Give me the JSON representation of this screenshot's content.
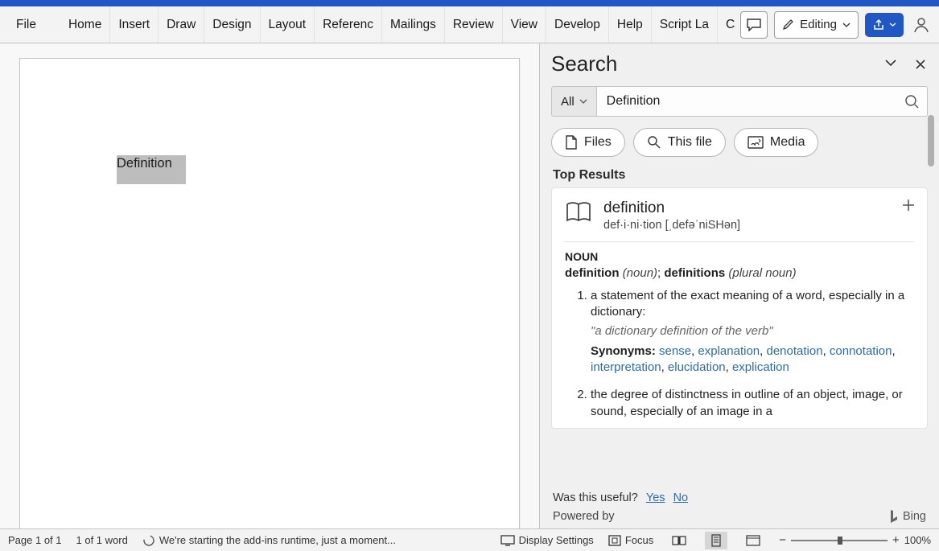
{
  "ribbon": {
    "tabs": [
      "File",
      "Home",
      "Insert",
      "Draw",
      "Design",
      "Layout",
      "Referenc",
      "Mailings",
      "Review",
      "View",
      "Develop",
      "Help",
      "Script La",
      "Callout a"
    ],
    "editing_label": "Editing"
  },
  "document": {
    "selection_text": "Definition"
  },
  "search": {
    "title": "Search",
    "scope": "All",
    "query": "Definition",
    "pills": [
      {
        "label": "Files"
      },
      {
        "label": "This file"
      },
      {
        "label": "Media"
      }
    ],
    "top_results_label": "Top Results",
    "dictionary": {
      "word": "definition",
      "syllables": "def·i·ni·tion",
      "pronunciation": "[ˌdefəˈniSHən]",
      "pos": "NOUN",
      "forms_singular": "definition",
      "forms_singular_paren": "(noun)",
      "forms_plural": "definitions",
      "forms_plural_paren": "(plural noun)",
      "defs": [
        {
          "text": "a statement of the exact meaning of a word, especially in a dictionary:",
          "example": "\"a dictionary definition of the verb\"",
          "synonyms": [
            "sense",
            "explanation",
            "denotation",
            "connotation",
            "interpretation",
            "elucidation",
            "explication"
          ]
        },
        {
          "text": "the degree of distinctness in outline of an object, image, or sound, especially of an image in a"
        }
      ],
      "syn_label": "Synonyms:"
    },
    "feedback": {
      "prompt": "Was this useful?",
      "yes": "Yes",
      "no": "No"
    },
    "powered": "Powered by",
    "bing": "Bing"
  },
  "status": {
    "page": "Page 1 of 1",
    "words": "1 of 1 word",
    "addin_msg": "We're starting the add-ins runtime, just a moment...",
    "display_settings": "Display Settings",
    "focus": "Focus",
    "zoom": "100%"
  }
}
